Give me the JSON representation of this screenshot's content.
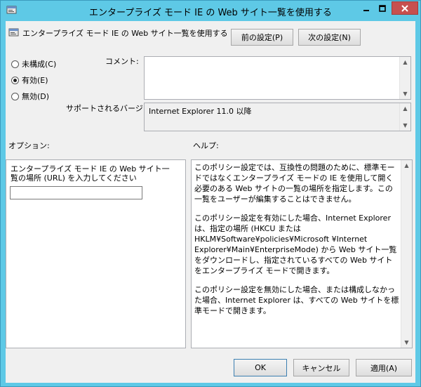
{
  "window": {
    "title": "エンタープライズ モード IE の Web サイト一覧を使用する"
  },
  "header": {
    "policy_name": "エンタープライズ モード IE の Web サイト一覧を使用する",
    "prev_button": "前の設定(P)",
    "next_button": "次の設定(N)"
  },
  "state": {
    "not_configured": "未構成(C)",
    "enabled": "有効(E)",
    "disabled": "無効(D)",
    "selected": "enabled"
  },
  "comment": {
    "label": "コメント:",
    "value": ""
  },
  "supported": {
    "label": "サポートされるバージョン:",
    "value": "Internet Explorer 11.0 以降"
  },
  "options": {
    "label": "オプション:",
    "field_label": "エンタープライズ モード IE の Web サイト一覧の場所 (URL) を入力してください",
    "field_value": ""
  },
  "help": {
    "label": "ヘルプ:",
    "paragraphs": [
      "このポリシー設定では、互換性の問題のために、標準モードではなくエンタープライズ モードの IE を使用して開く必要のある Web サイトの一覧の場所を指定します。この一覧をユーザーが編集することはできません。",
      "このポリシー設定を有効にした場合、Internet Explorer は、指定の場所 (HKCU または HKLM¥Software¥policies¥Microsoft ¥Internet Explorer¥Main¥EnterpriseMode) から Web サイト一覧をダウンロードし、指定されているすべての Web サイトをエンタープライズ モードで開きます。",
      "このポリシー設定を無効にした場合、または構成しなかった場合、Internet Explorer は、すべての Web サイトを標準モードで開きます。"
    ]
  },
  "footer": {
    "ok": "OK",
    "cancel": "キャンセル",
    "apply": "適用(A)"
  }
}
